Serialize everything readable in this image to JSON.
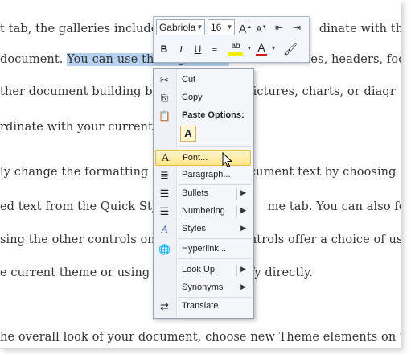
{
  "document": {
    "lines": [
      {
        "pre": "t tab, the galleries include it",
        "hl": "",
        "post": "",
        "tail": "dinate with the ov"
      },
      {
        "pre": "document. ",
        "hl": "You can use these galleries",
        "post": " to insert tables, headers, footers, lists",
        "tail": ""
      },
      {
        "pre": "ther document building blo",
        "hl": "",
        "post": "",
        "tail": "ate pictures, charts, or diagr"
      },
      {
        "pre": "rdinate with your current d",
        "hl": "",
        "post": "",
        "tail": ""
      },
      {
        "pre": "ly change the formatting of s",
        "hl": "",
        "post": "",
        "tail": "document text by choosing"
      },
      {
        "pre": "ed text from the Quick Style",
        "hl": "",
        "post": "",
        "tail": "me tab. You can also format"
      },
      {
        "pre": "sing the other controls on th",
        "hl": "",
        "post": "",
        "tail": "controls offer a choice of usi"
      },
      {
        "pre": "e current theme or using a f",
        "hl": "",
        "post": "",
        "tail": "cify directly."
      },
      {
        "pre": "he overall look of your document, choose new Theme elements on the Page L",
        "hl": "",
        "post": "",
        "tail": ""
      }
    ]
  },
  "mini_toolbar": {
    "font_name": "Gabriola",
    "font_size": "16",
    "grow_label": "A",
    "shrink_label": "A",
    "bold": "B",
    "italic": "I",
    "underline": "U",
    "highlight_label": "ab",
    "font_color_label": "A",
    "accent_colors": {
      "highlight": "#f2ee00",
      "font_color": "#d11919"
    }
  },
  "context_menu": {
    "items": [
      {
        "label": "Cut",
        "icon": "scissors-icon",
        "glyph": "✂"
      },
      {
        "label": "Copy",
        "icon": "copy-icon",
        "glyph": "⎘"
      },
      {
        "label": "Paste Options:",
        "icon": "paste-icon",
        "glyph": "📋"
      },
      {
        "label": "A",
        "icon": "paste-keep-text-only-icon"
      },
      {
        "label": "Font...",
        "icon": "font-icon",
        "glyph": "A"
      },
      {
        "label": "Paragraph...",
        "icon": "paragraph-icon",
        "glyph": "≣"
      },
      {
        "label": "Bullets",
        "icon": "bullets-icon",
        "glyph": "☰"
      },
      {
        "label": "Numbering",
        "icon": "numbering-icon",
        "glyph": "☰"
      },
      {
        "label": "Styles",
        "icon": "styles-icon",
        "glyph": "A"
      },
      {
        "label": "Hyperlink...",
        "icon": "hyperlink-icon",
        "glyph": "🌐"
      },
      {
        "label": "Look Up",
        "icon": "",
        "glyph": ""
      },
      {
        "label": "Synonyms",
        "icon": "",
        "glyph": ""
      },
      {
        "label": "Translate",
        "icon": "translate-icon",
        "glyph": "⇄"
      }
    ],
    "submenu_arrow": "▶",
    "hover_item": "Font..."
  }
}
